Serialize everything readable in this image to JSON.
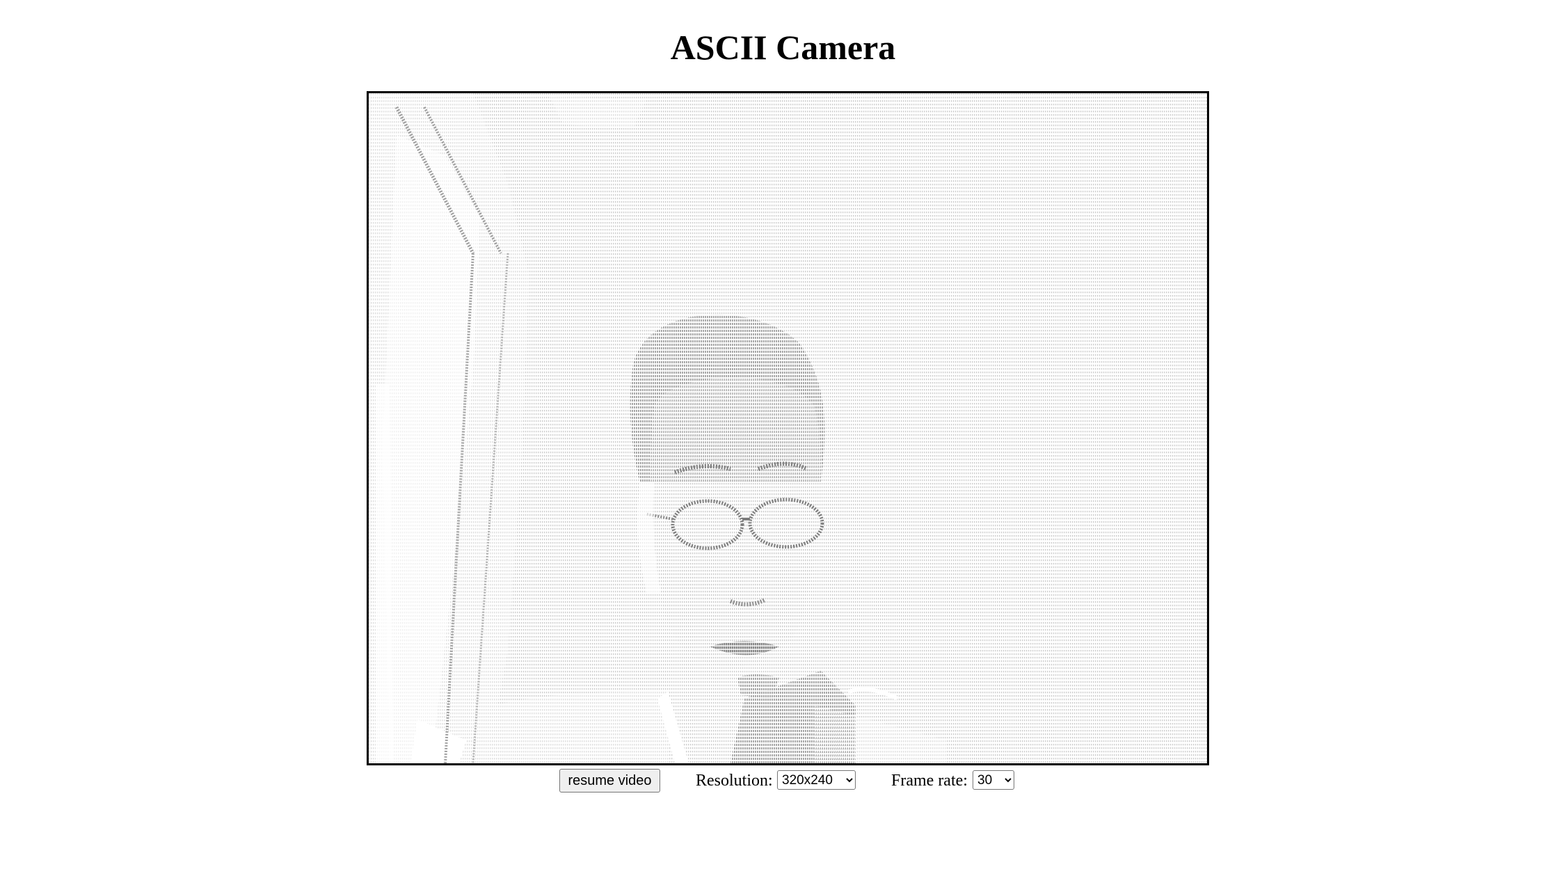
{
  "page": {
    "title": "ASCII Camera"
  },
  "controls": {
    "resume_label": "resume video",
    "resolution_label": "Resolution:",
    "resolution_value": "320x240",
    "frame_rate_label": "Frame rate:",
    "frame_rate_value": "30"
  },
  "colors": {
    "ascii_light": "#d9d9d9",
    "ascii_mid": "#b4b4b4",
    "ascii_dark": "#8e8e8e",
    "frame_border": "#000000"
  }
}
